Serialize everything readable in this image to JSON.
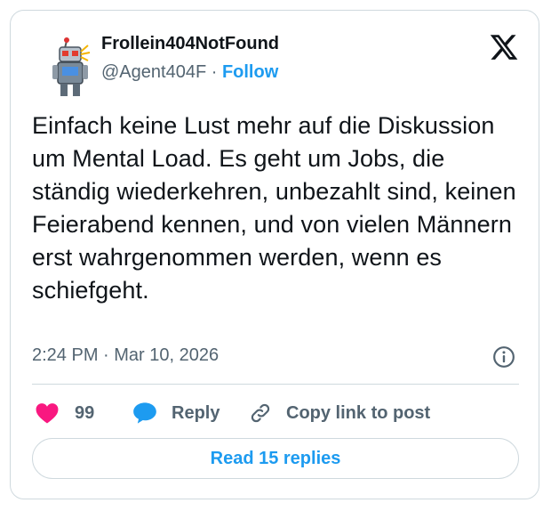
{
  "author": {
    "display_name": "Frollein404NotFound",
    "handle": "@Agent404F",
    "separator": " · ",
    "follow_label": "Follow"
  },
  "tweet": {
    "text": "Einfach keine Lust mehr auf die Diskussion um Mental Load. Es geht um Jobs, die ständig wiederkehren, unbezahlt sind, keinen Feierabend kennen, und von vielen Männern erst wahrgenommen werden, wenn es schiefgeht.",
    "timestamp": "2:24 PM · Mar 10, 2026"
  },
  "actions": {
    "like_count": "99",
    "reply_label": "Reply",
    "copy_label": "Copy link to post"
  },
  "read_replies_label": "Read 15 replies",
  "colors": {
    "accent": "#1d9bf0",
    "like": "#f91880",
    "text": "#0f1419",
    "muted": "#536471",
    "border": "#cfd9de"
  },
  "icons": [
    "robot-avatar-icon",
    "x-logo-icon",
    "info-icon",
    "heart-icon",
    "reply-bubble-icon",
    "link-icon"
  ]
}
